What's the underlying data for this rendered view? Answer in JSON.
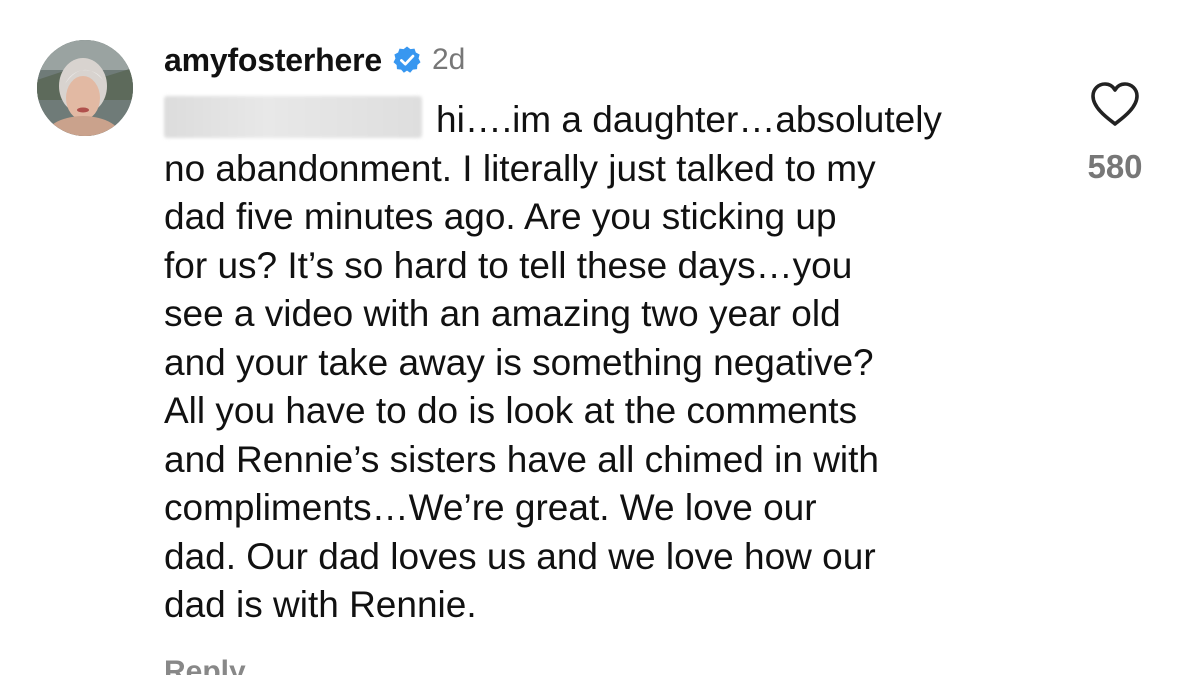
{
  "comment": {
    "username": "amyfosterhere",
    "timestamp": "2d",
    "verified": true,
    "mention_redacted": true,
    "line1": "hi….im a daughter…absolutely",
    "lines_rest": "no abandonment. I literally just talked to my\ndad five minutes ago. Are you sticking up\nfor us? It’s so hard to tell these days…you\nsee a video with an amazing two year old\nand your take away is something negative?\nAll you have to do is look at the comments\nand Rennie’s sisters have all chimed in with\ncompliments…We’re great. We love our\ndad. Our dad loves us and we love how our\ndad is with Rennie.",
    "like_count": "580",
    "reply_label": "Reply"
  },
  "colors": {
    "verified_badge": "#3897f0",
    "secondary_text": "#777777"
  },
  "icons": {
    "like": "heart-outline-icon",
    "verified": "verified-badge-icon"
  }
}
